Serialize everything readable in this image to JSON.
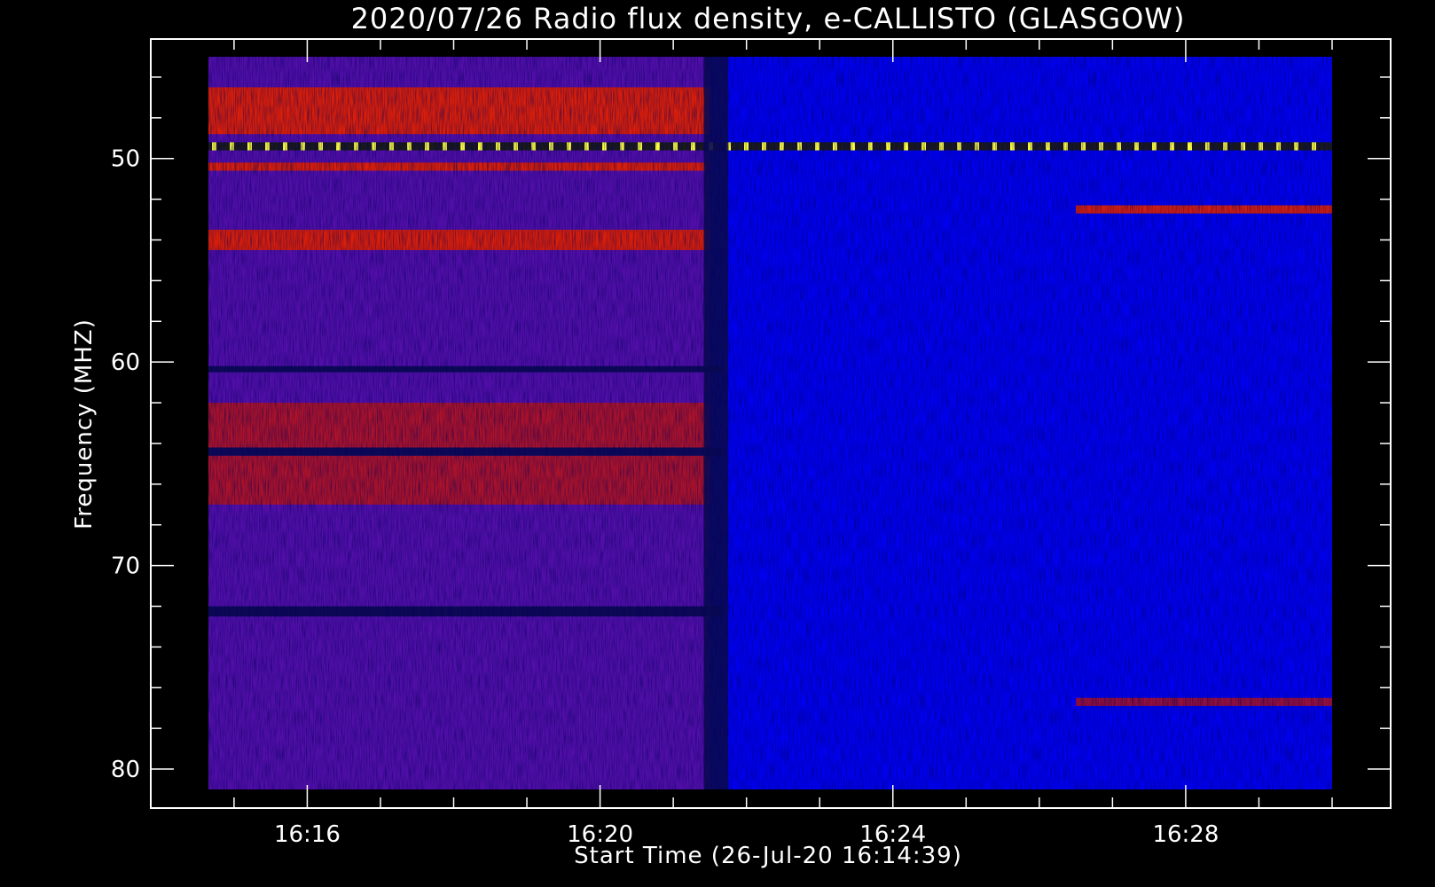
{
  "chart_data": {
    "type": "heatmap",
    "title": "2020/07/26  Radio flux density, e-CALLISTO (GLASGOW)",
    "xlabel": "Start Time (26-Jul-20 16:14:39)",
    "ylabel": "Frequency (MHZ)",
    "x_range": [
      "16:14:39",
      "16:30:00"
    ],
    "y_range": [
      45,
      81
    ],
    "y_inverted": true,
    "x_ticks": [
      "16:16",
      "16:20",
      "16:24",
      "16:28"
    ],
    "y_ticks": [
      50,
      60,
      70,
      80
    ],
    "colors": {
      "background": "#0000f0",
      "frame": "#000000",
      "red_band": "#c81400",
      "dark_band": "#0a0a50",
      "hot": "#ffff40"
    },
    "features": [
      {
        "name": "elevated background",
        "time_start": "16:14:39",
        "time_end": "16:21:30",
        "freq_start": 45,
        "freq_end": 81
      },
      {
        "name": "strong band",
        "time_start": "16:14:39",
        "time_end": "16:21:30",
        "freq_start": 46.5,
        "freq_end": 48.8
      },
      {
        "name": "strong band",
        "time_start": "16:14:39",
        "time_end": "16:21:30",
        "freq_start": 50.2,
        "freq_end": 50.6
      },
      {
        "name": "strong band",
        "time_start": "16:14:39",
        "time_end": "16:21:30",
        "freq_start": 53.5,
        "freq_end": 54.5
      },
      {
        "name": "moderate band",
        "time_start": "16:14:39",
        "time_end": "16:21:30",
        "freq_start": 62.0,
        "freq_end": 64.2
      },
      {
        "name": "moderate band",
        "time_start": "16:14:39",
        "time_end": "16:21:30",
        "freq_start": 64.6,
        "freq_end": 67.0
      },
      {
        "name": "absorption line",
        "time_start": "16:14:39",
        "time_end": "16:21:40",
        "freq_start": 64.2,
        "freq_end": 64.6
      },
      {
        "name": "absorption line",
        "time_start": "16:14:39",
        "time_end": "16:21:40",
        "freq_start": 60.2,
        "freq_end": 60.5
      },
      {
        "name": "absorption line",
        "time_start": "16:14:39",
        "time_end": "16:21:40",
        "freq_start": 72.0,
        "freq_end": 72.5
      },
      {
        "name": "interference line",
        "time_start": "16:14:39",
        "time_end": "16:30:00",
        "freq_start": 49.2,
        "freq_end": 49.6
      },
      {
        "name": "broadband dropout",
        "time_start": "16:21:25",
        "time_end": "16:21:45",
        "freq_start": 45,
        "freq_end": 81
      },
      {
        "name": "strong band",
        "time_start": "16:26:30",
        "time_end": "16:30:00",
        "freq_start": 52.3,
        "freq_end": 52.7
      },
      {
        "name": "moderate band",
        "time_start": "16:26:30",
        "time_end": "16:30:00",
        "freq_start": 76.5,
        "freq_end": 76.9
      }
    ]
  }
}
